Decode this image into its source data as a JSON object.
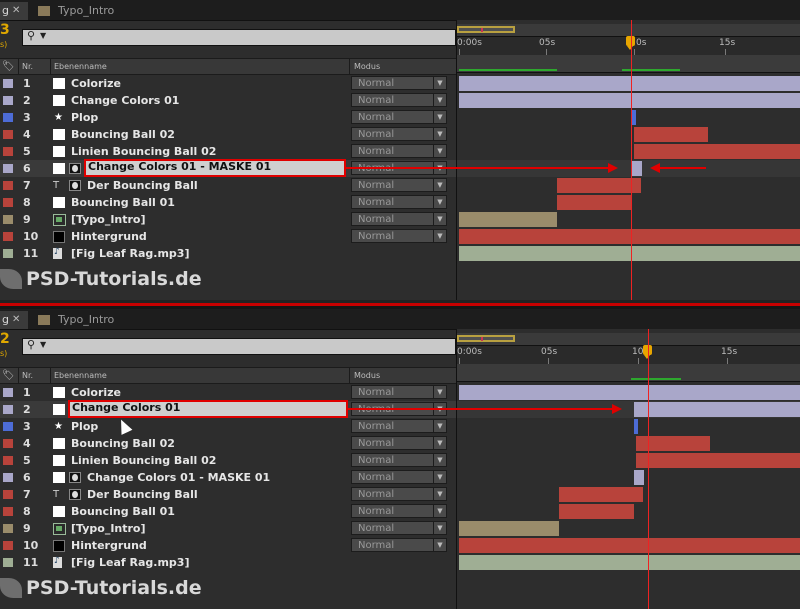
{
  "colors": {
    "red": "#b8433b",
    "lavender": "#a9a7c9",
    "blue": "#4d6cd6",
    "khaki": "#9a8c6b",
    "sage": "#9fae94"
  },
  "panels": [
    {
      "tab_active": "g",
      "tab_inactive": "Typo_Intro",
      "timecode": "3",
      "fps": "s)",
      "search": {
        "icon": "search-icon"
      },
      "columns": {
        "nr": "Nr.",
        "name": "Ebenenname",
        "modus": "Modus"
      },
      "time_labels": [
        "0:00s",
        "05s",
        "0s",
        "15s"
      ],
      "layers": [
        {
          "num": "1",
          "name": "Colorize",
          "modus": "Normal",
          "label": "lavender",
          "icon": "solid"
        },
        {
          "num": "2",
          "name": "Change Colors 01",
          "modus": "Normal",
          "label": "lavender",
          "icon": "solid"
        },
        {
          "num": "3",
          "name": "Plop",
          "modus": "Normal",
          "label": "blue",
          "icon": "star"
        },
        {
          "num": "4",
          "name": "Bouncing Ball 02",
          "modus": "Normal",
          "label": "red",
          "icon": "solid"
        },
        {
          "num": "5",
          "name": "Linien Bouncing Ball 02",
          "modus": "Normal",
          "label": "red",
          "icon": "solid"
        },
        {
          "num": "6",
          "name": "Change Colors 01 - MASKE 01",
          "modus": "Normal",
          "label": "lavender",
          "icon": "solid"
        },
        {
          "num": "7",
          "name": "Der Bouncing Ball",
          "modus": "Normal",
          "label": "red",
          "icon": "text"
        },
        {
          "num": "8",
          "name": "Bouncing Ball 01",
          "modus": "Normal",
          "label": "red",
          "icon": "solid"
        },
        {
          "num": "9",
          "name": "[Typo_Intro]",
          "modus": "Normal",
          "label": "khaki",
          "icon": "comp"
        },
        {
          "num": "10",
          "name": "Hintergrund",
          "modus": "Normal",
          "label": "red",
          "icon": "black"
        },
        {
          "num": "11",
          "name": "[Fig Leaf Rag.mp3]",
          "modus": "",
          "label": "sage",
          "icon": "audio"
        }
      ]
    },
    {
      "tab_active": "g",
      "tab_inactive": "Typo_Intro",
      "timecode": "2",
      "fps": "s)",
      "search": {
        "icon": "search-icon"
      },
      "columns": {
        "nr": "Nr.",
        "name": "Ebenenname",
        "modus": "Modus"
      },
      "time_labels": [
        "0:00s",
        "05s",
        "10s",
        "15s"
      ],
      "layers": [
        {
          "num": "1",
          "name": "Colorize",
          "modus": "Normal",
          "label": "lavender",
          "icon": "solid"
        },
        {
          "num": "2",
          "name": "Change Colors 01",
          "modus": "Normal",
          "label": "lavender",
          "icon": "solid"
        },
        {
          "num": "3",
          "name": "Plop",
          "modus": "Normal",
          "label": "blue",
          "icon": "star"
        },
        {
          "num": "4",
          "name": "Bouncing Ball 02",
          "modus": "Normal",
          "label": "red",
          "icon": "solid"
        },
        {
          "num": "5",
          "name": "Linien Bouncing Ball 02",
          "modus": "Normal",
          "label": "red",
          "icon": "solid"
        },
        {
          "num": "6",
          "name": "Change Colors 01 - MASKE 01",
          "modus": "Normal",
          "label": "lavender",
          "icon": "solid"
        },
        {
          "num": "7",
          "name": "Der Bouncing Ball",
          "modus": "Normal",
          "label": "red",
          "icon": "text"
        },
        {
          "num": "8",
          "name": "Bouncing Ball 01",
          "modus": "Normal",
          "label": "red",
          "icon": "solid"
        },
        {
          "num": "9",
          "name": "[Typo_Intro]",
          "modus": "Normal",
          "label": "khaki",
          "icon": "comp"
        },
        {
          "num": "10",
          "name": "Hintergrund",
          "modus": "Normal",
          "label": "red",
          "icon": "black"
        },
        {
          "num": "11",
          "name": "[Fig Leaf Rag.mp3]",
          "modus": "",
          "label": "sage",
          "icon": "audio"
        }
      ]
    }
  ],
  "watermark": "PSD-Tutorials.de"
}
